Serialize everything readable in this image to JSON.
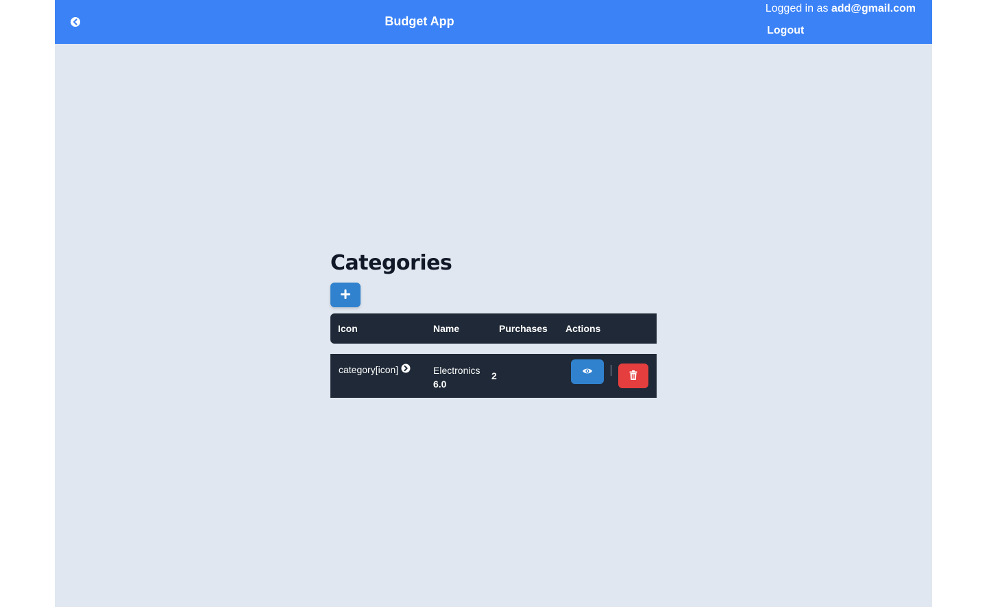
{
  "navbar": {
    "title": "Budget App",
    "logged_in_prefix": "Logged in as",
    "user_email": "add@gmail.com",
    "logout_label": "Logout"
  },
  "page": {
    "title": "Categories"
  },
  "table": {
    "headers": [
      "Icon",
      "Name",
      "Purchases",
      "Actions"
    ],
    "rows": [
      {
        "icon_text": "category[icon]",
        "name": "Electronics",
        "amount": "6.0",
        "purchases": "2"
      }
    ]
  },
  "colors": {
    "navbar": "#3b82f6",
    "background": "#e0e7f0",
    "table": "#1f2937",
    "primary_button": "#3182ce",
    "danger_button": "#e53e3e"
  },
  "icons": {
    "back": "chevron-circle-left-icon",
    "add": "plus-icon",
    "row_link": "chevron-circle-right-icon",
    "view": "eye-icon",
    "delete": "trash-icon"
  }
}
